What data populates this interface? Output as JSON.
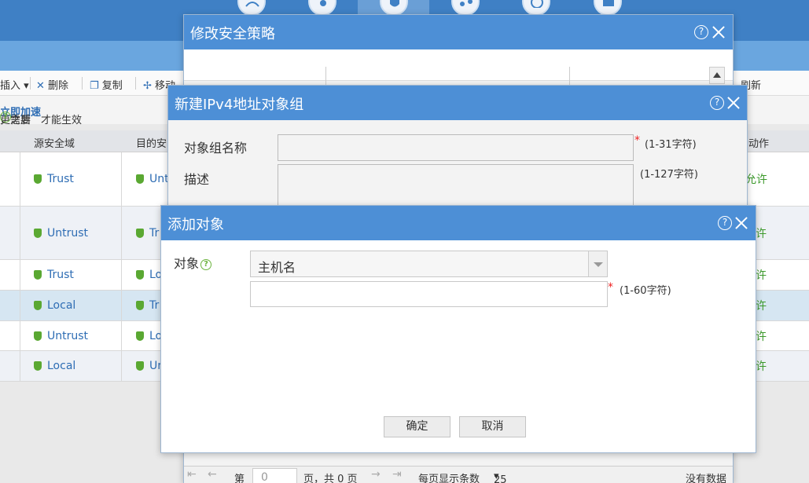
{
  "toolbar": {
    "insert": "插入",
    "delete": "删除",
    "copy": "复制",
    "move": "移动",
    "refresh": "刷新"
  },
  "notice": {
    "prefix": "更之后",
    "mid": "，需要",
    "link": "立即加速",
    "suffix": "才能生效"
  },
  "grid": {
    "headers": {
      "src_zone": "源安全域",
      "dst_zone": "目的安",
      "action": "动作"
    },
    "rows": [
      {
        "src": "Trust",
        "dst": "Unt",
        "action": "允许"
      },
      {
        "src": "Untrust",
        "dst": "Tr",
        "action": "许"
      },
      {
        "src": "Trust",
        "dst": "Lo",
        "action": "许"
      },
      {
        "src": "Local",
        "dst": "Tr",
        "action": "许"
      },
      {
        "src": "Untrust",
        "dst": "Lo",
        "action": "许"
      },
      {
        "src": "Local",
        "dst": "Ur",
        "action": "许"
      }
    ]
  },
  "dialog_policy": {
    "title": "修改安全策略",
    "pager": {
      "page_prefix": "第",
      "page_value": "0",
      "page_suffix": "页，共 0 页",
      "per_page_label": "每页显示条数",
      "per_page_value": "25",
      "no_data": "没有数据"
    }
  },
  "dialog_group": {
    "title": "新建IPv4地址对象组",
    "name_label": "对象组名称",
    "name_hint": "(1-31字符)",
    "desc_label": "描述",
    "desc_hint": "(1-127字符)"
  },
  "dialog_add": {
    "title": "添加对象",
    "object_label": "对象",
    "object_type": "主机名",
    "host_value": "",
    "host_hint": "(1-60字符)",
    "ok": "确定",
    "cancel": "取消"
  },
  "colors": {
    "title_bar": "#4d8fd6",
    "top_nav": "#3f80c5",
    "zone_text": "#2e6db4",
    "allow_text": "#3c9a2c",
    "required": "#e22222"
  }
}
